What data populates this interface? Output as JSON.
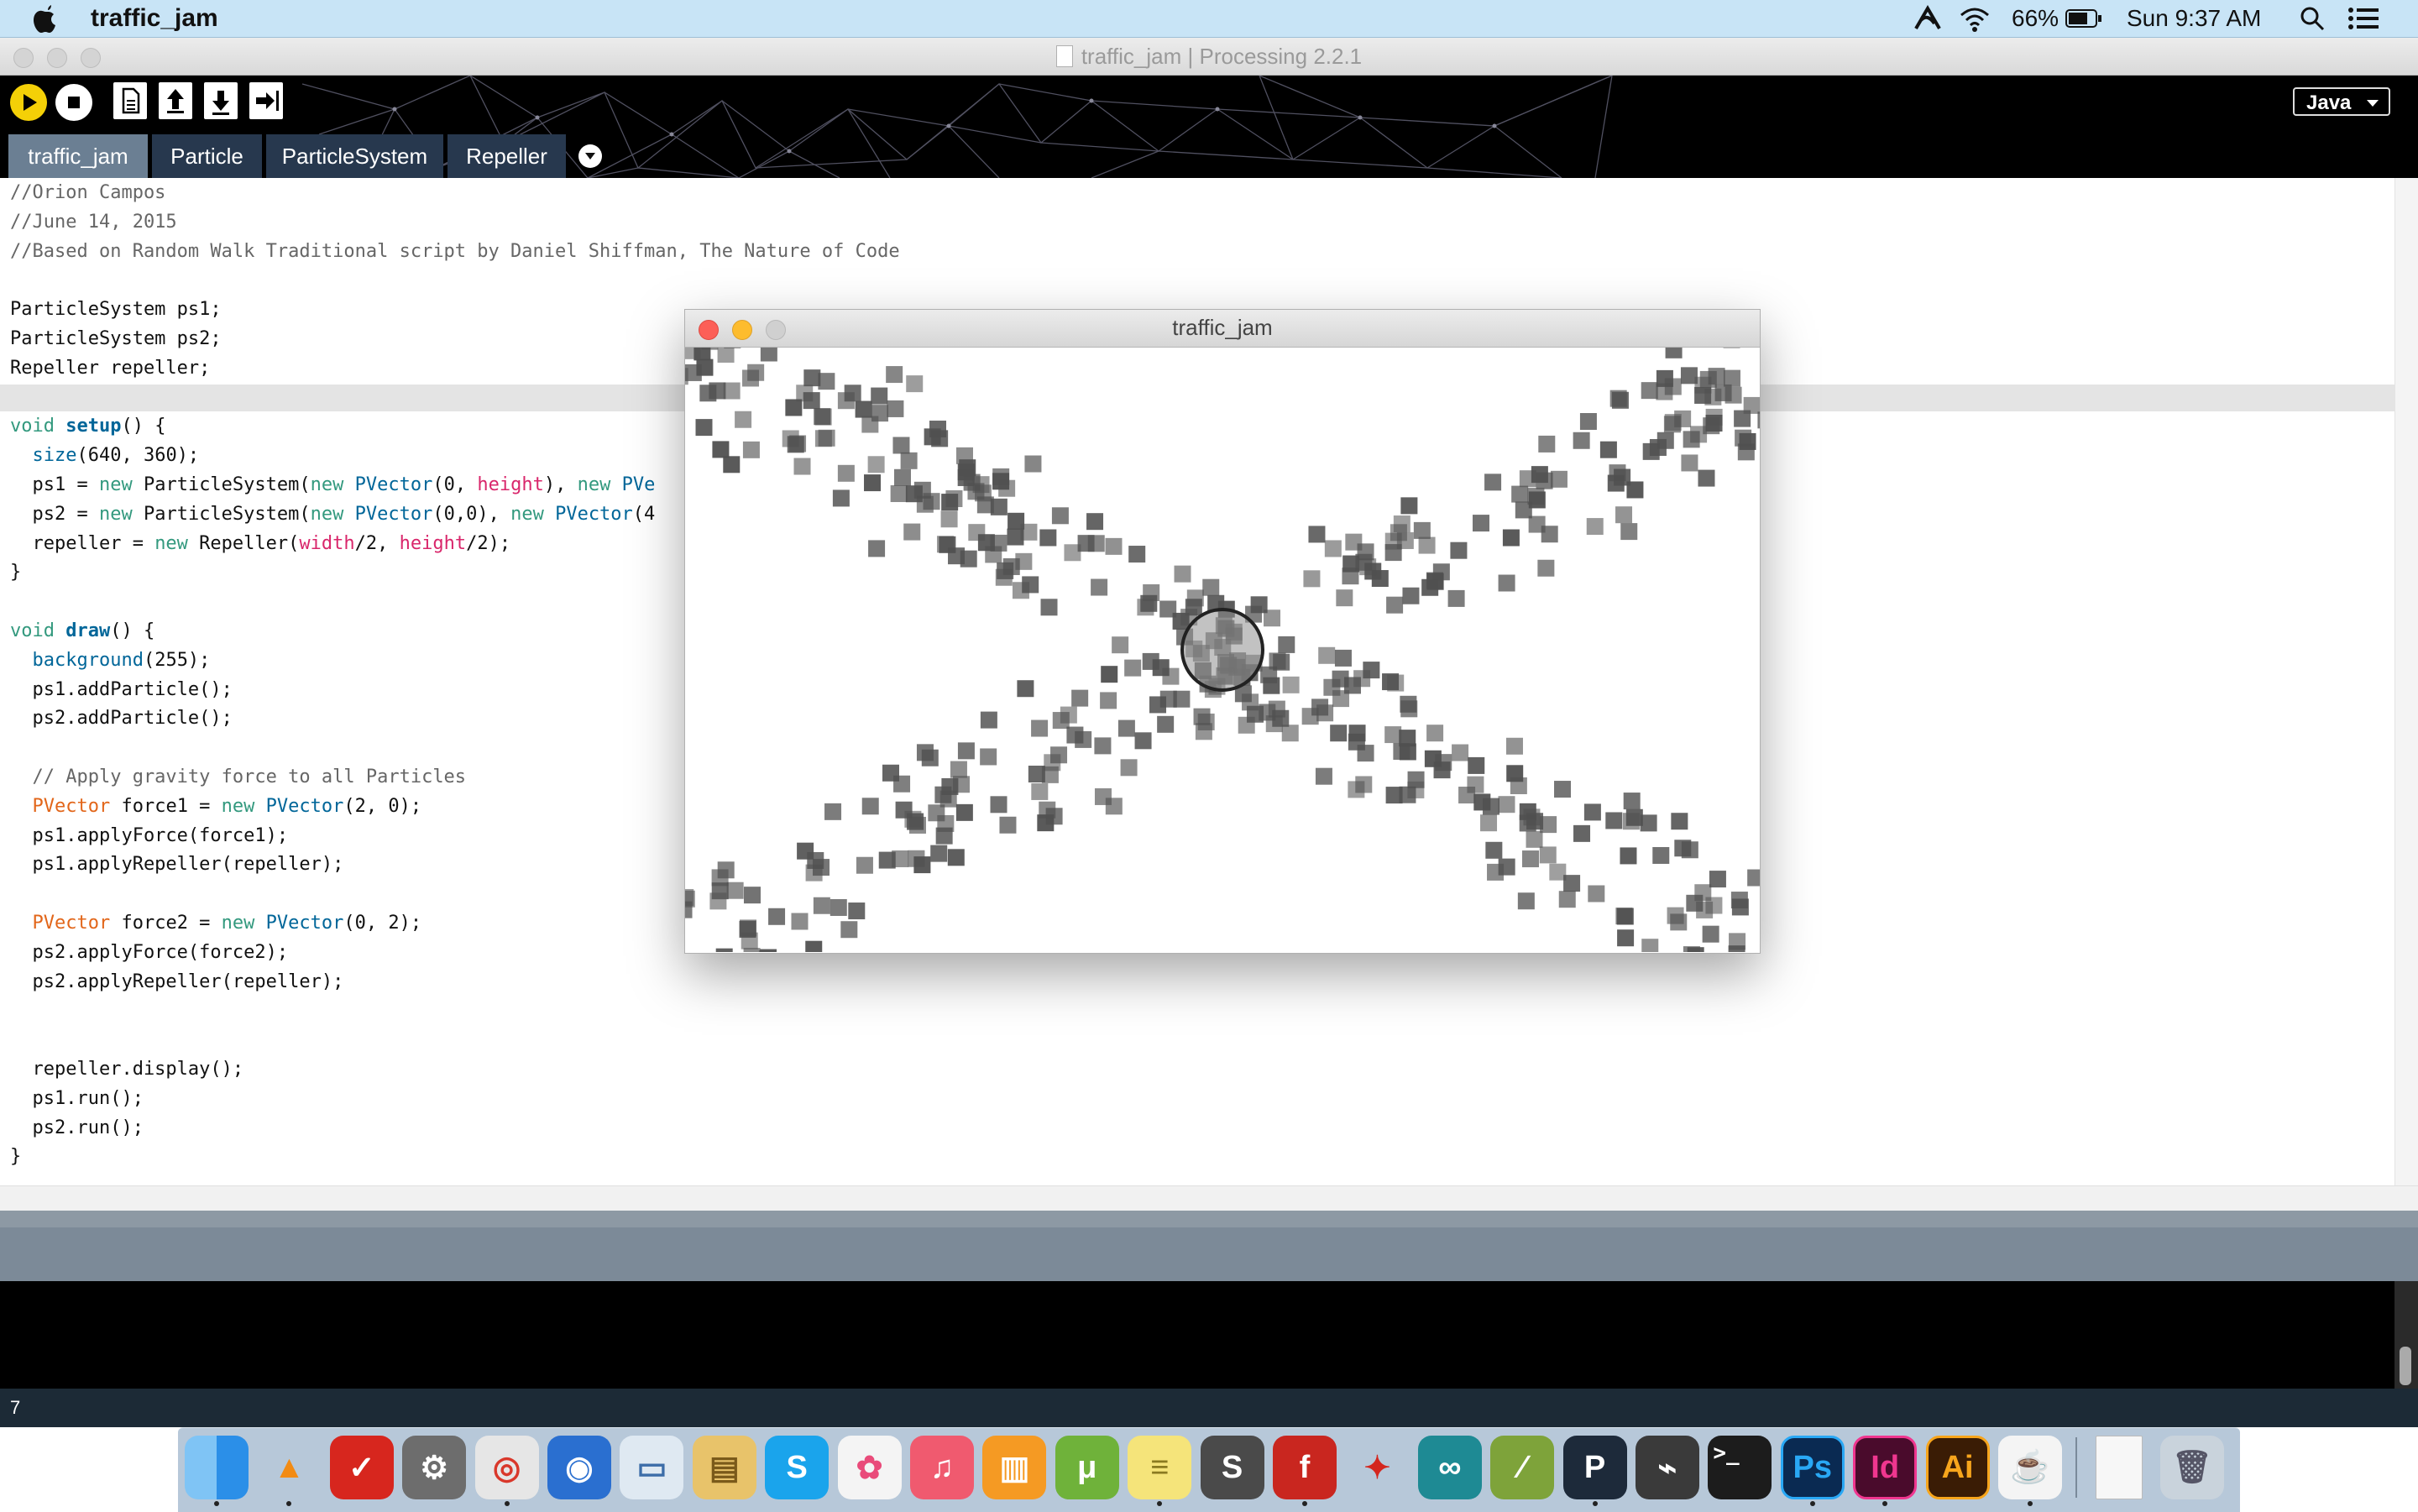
{
  "menubar": {
    "app_name": "traffic_jam",
    "battery": "66%",
    "clock": "Sun 9:37 AM"
  },
  "window": {
    "title": "traffic_jam | Processing 2.2.1"
  },
  "toolbar": {
    "mode_label": "Java",
    "tabs": [
      "traffic_jam",
      "Particle",
      "ParticleSystem",
      "Repeller"
    ]
  },
  "editor": {
    "lines": [
      "//Orion Campos",
      "//June 14, 2015",
      "//Based on Random Walk Traditional script by Daniel Shiffman, The Nature of Code",
      "",
      "ParticleSystem ps1;",
      "ParticleSystem ps2;",
      "Repeller repeller;",
      "",
      "void setup() {",
      "  size(640, 360);",
      "  ps1 = new ParticleSystem(new PVector(0, height), new PVe",
      "  ps2 = new ParticleSystem(new PVector(0,0), new PVector(4",
      "  repeller = new Repeller(width/2, height/2);",
      "}",
      "",
      "void draw() {",
      "  background(255);",
      "  ps1.addParticle();",
      "  ps2.addParticle();",
      "",
      "  // Apply gravity force to all Particles",
      "  PVector force1 = new PVector(2, 0);",
      "  ps1.applyForce(force1);",
      "  ps1.applyRepeller(repeller);",
      "",
      "  PVector force2 = new PVector(0, 2);",
      "  ps2.applyForce(force2);",
      "  ps2.applyRepeller(repeller);",
      "",
      "",
      "  repeller.display();",
      "  ps1.run();",
      "  ps2.run();",
      "}"
    ],
    "highlighted_line": 7
  },
  "console": {
    "line_number": "7"
  },
  "sketch": {
    "title": "traffic_jam"
  },
  "colors": {
    "menubar": "#c8e4f6",
    "header": "#000000",
    "tab": "#27384e",
    "tab_active": "#6b7f93",
    "comment": "#666666",
    "keyword": "#33997e",
    "type": "#e2661a",
    "function": "#006699",
    "variable": "#d9266b",
    "particle": "#5a5a5a"
  },
  "dock": {
    "icons": [
      "finder-icon",
      "vlc-icon",
      "avira-icon",
      "system-preferences-icon",
      "chrome-icon",
      "google-earth-icon",
      "preview-icon",
      "archive-utility-icon",
      "skype-icon",
      "photos-icon",
      "itunes-icon",
      "ibooks-icon",
      "utorrent-icon",
      "notes-icon",
      "sublime-text-icon",
      "flash-icon",
      "adobe-air-icon",
      "arduino-icon",
      "gps-icon",
      "processing-icon",
      "ffmpeg-icon",
      "terminal-icon",
      "photoshop-icon",
      "indesign-icon",
      "illustrator-icon",
      "java-icon",
      "document-icon",
      "trash-icon"
    ],
    "labels": {
      "photoshop": "Ps",
      "indesign": "Id",
      "illustrator": "Ai",
      "processing": "P",
      "flash": "f"
    }
  }
}
